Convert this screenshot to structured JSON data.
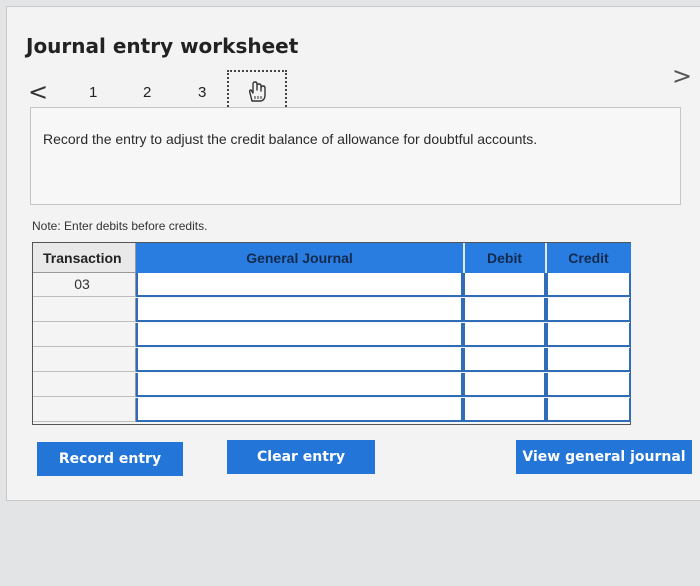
{
  "worksheet": {
    "title": "Journal entry worksheet",
    "nav": {
      "prev_glyph": "<",
      "next_glyph": ">",
      "steps": [
        "1",
        "2",
        "3"
      ],
      "current_step_icon": "hand-pointer-icon"
    },
    "instruction": "Record the entry to adjust the credit balance of allowance for doubtful accounts.",
    "note": "Note: Enter debits before credits."
  },
  "journal": {
    "headers": {
      "transaction": "Transaction",
      "general_journal": "General Journal",
      "debit": "Debit",
      "credit": "Credit"
    },
    "rows": [
      {
        "transaction": "03",
        "account": "",
        "debit": "",
        "credit": ""
      },
      {
        "transaction": "",
        "account": "",
        "debit": "",
        "credit": ""
      },
      {
        "transaction": "",
        "account": "",
        "debit": "",
        "credit": ""
      },
      {
        "transaction": "",
        "account": "",
        "debit": "",
        "credit": ""
      },
      {
        "transaction": "",
        "account": "",
        "debit": "",
        "credit": ""
      },
      {
        "transaction": "",
        "account": "",
        "debit": "",
        "credit": ""
      }
    ]
  },
  "buttons": {
    "record": "Record entry",
    "clear": "Clear entry",
    "view": "View general journal"
  },
  "colors": {
    "accent": "#2475d8",
    "header_blue": "#2a7de0",
    "cell_border": "#2f6db8"
  }
}
